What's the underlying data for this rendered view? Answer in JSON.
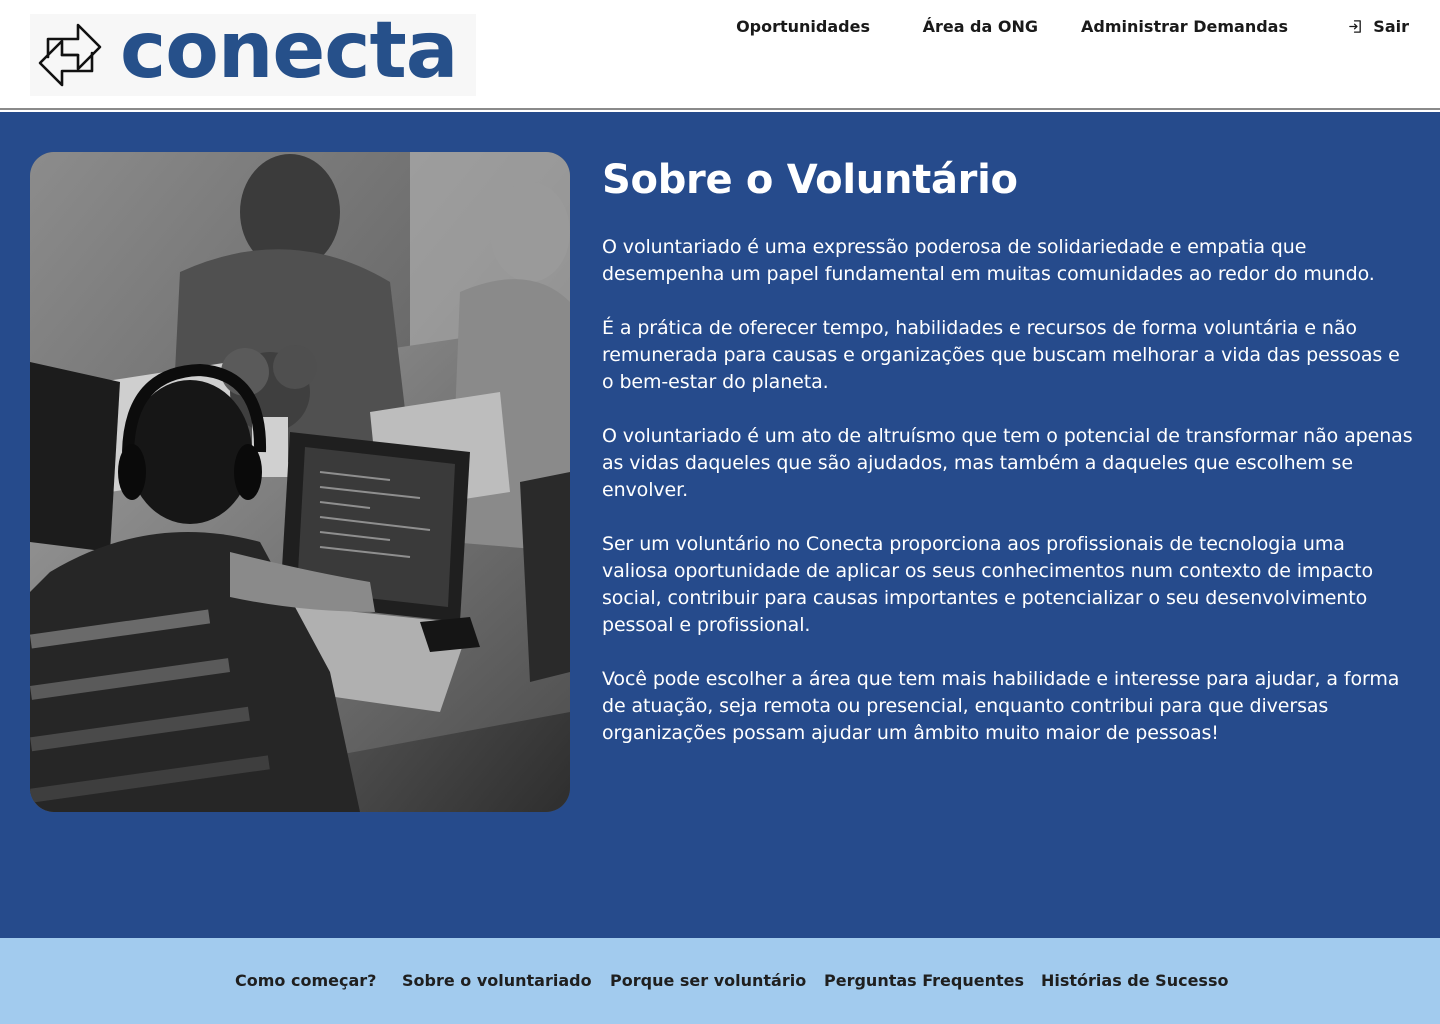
{
  "brand": {
    "name": "conecta",
    "icon": "arrows-exchange-icon",
    "color": "#26508a"
  },
  "nav": {
    "items": [
      {
        "label": "Oportunidades"
      },
      {
        "label": "Área da ONG"
      },
      {
        "label": "Administrar Demandas"
      }
    ],
    "logout": {
      "label": "Sair",
      "icon": "logout-icon"
    }
  },
  "main": {
    "background": "#264b8c",
    "image": {
      "icon": "volunteers-photo"
    },
    "title": "Sobre o Voluntário",
    "paragraphs": [
      "O voluntariado é uma expressão poderosa de solidariedade e empatia que desempenha um papel fundamental em muitas comunidades ao redor do mundo.",
      "É a prática de oferecer tempo, habilidades e recursos de forma voluntária e não remunerada para causas e organizações que buscam melhorar a vida das pessoas e o bem-estar do planeta.",
      "O voluntariado é um ato de altruísmo que tem o potencial de transformar não apenas as vidas daqueles que são ajudados, mas também a daqueles que escolhem se envolver.",
      "Ser um voluntário no Conecta proporciona aos profissionais de tecnologia uma valiosa oportunidade de aplicar os seus conhecimentos num contexto de impacto social, contribuir para causas importantes e potencializar o seu desenvolvimento pessoal e profissional.",
      "Você pode escolher a área que tem mais habilidade e interesse para ajudar, a forma de atuação, seja remota ou presencial, enquanto contribui para que diversas organizações possam ajudar um âmbito muito maior de pessoas!"
    ]
  },
  "footer": {
    "background": "#a2cbee",
    "links": [
      {
        "label": "Como começar?"
      },
      {
        "label": "Sobre o voluntariado"
      },
      {
        "label": "Porque ser voluntário"
      },
      {
        "label": "Perguntas Frequentes"
      },
      {
        "label": "Histórias de Sucesso"
      }
    ]
  }
}
